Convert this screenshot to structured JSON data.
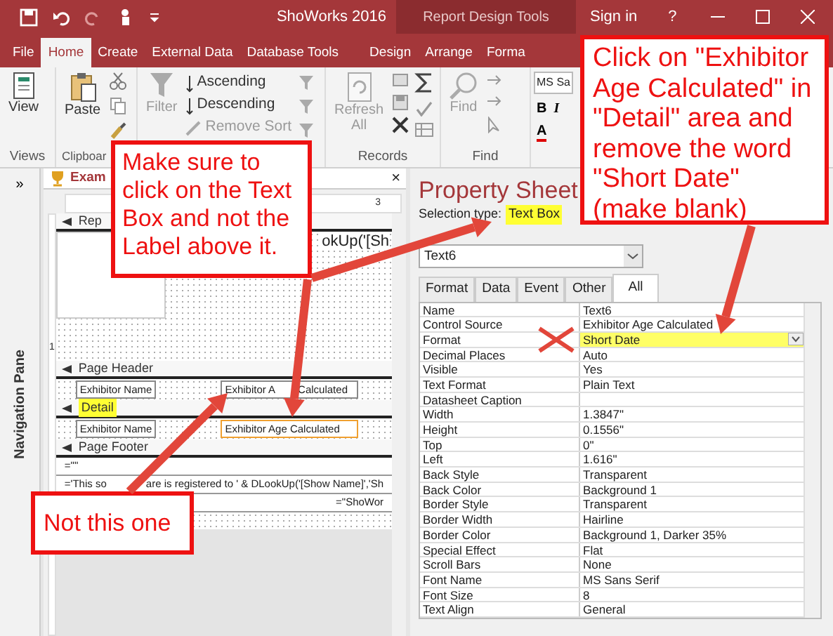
{
  "title_bar": {
    "title": "ShoWorks 2016",
    "context": "Report Design Tools",
    "sign_in": "Sign in",
    "help": "?"
  },
  "ribbon_tabs": [
    {
      "label": "File",
      "selected": false
    },
    {
      "label": "Home",
      "selected": true
    },
    {
      "label": "Create",
      "selected": false
    },
    {
      "label": "External Data",
      "selected": false
    },
    {
      "label": "Database Tools",
      "selected": false
    },
    {
      "label": "Design",
      "selected": false
    },
    {
      "label": "Arrange",
      "selected": false
    },
    {
      "label": "Forma",
      "selected": false
    }
  ],
  "ribbon": {
    "view": "View",
    "paste": "Paste",
    "filter": {
      "label": "Filter",
      "disabled": true
    },
    "sort": [
      {
        "label": "Ascending",
        "disabled": false
      },
      {
        "label": "Descending",
        "disabled": false
      },
      {
        "label": "Remove Sort",
        "disabled": true
      }
    ],
    "refresh": {
      "lines": [
        "Refresh",
        "All"
      ],
      "disabled": true
    },
    "find": {
      "label": "Find",
      "disabled": true
    },
    "font_name": "MS Sa",
    "format_buttons": [
      "B",
      "I",
      "A"
    ],
    "group_labels": [
      "Views",
      "Clipboar",
      "Records",
      "Find"
    ]
  },
  "navigation_pane": {
    "expand": "»",
    "label": "Navigation Pane"
  },
  "report_design": {
    "tab": "Exam",
    "close": "×",
    "ruler_mark": "3",
    "side_mark": "1",
    "sections": [
      {
        "kind": "band",
        "label": "Rep",
        "highlighted": false
      },
      {
        "kind": "header_area",
        "text": "okUp('[Sh"
      },
      {
        "kind": "band",
        "label": "Page Header",
        "highlighted": false
      },
      {
        "kind": "controls",
        "cells": [
          {
            "texts": [
              "Exhibitor Name"
            ],
            "selected": false
          },
          {
            "texts": [
              "Exhibitor A",
              "Calculated"
            ],
            "selected": false
          }
        ]
      },
      {
        "kind": "band",
        "label": "Detail",
        "highlighted": true
      },
      {
        "kind": "controls",
        "cells": [
          {
            "texts": [
              "Exhibitor Name"
            ],
            "selected": false
          },
          {
            "texts": [
              "Exhibitor Age Calculated"
            ],
            "selected": true
          }
        ]
      },
      {
        "kind": "band",
        "label": "Page Footer",
        "highlighted": false
      },
      {
        "kind": "expression",
        "texts": [
          "=\"\""
        ]
      },
      {
        "kind": "expression",
        "texts": [
          "='This so",
          "are is registered to ' & DLookUp('[Show Name]','Sh"
        ]
      },
      {
        "kind": "right_expression",
        "texts": [
          "=\"ShoWor"
        ]
      }
    ]
  },
  "property_sheet": {
    "title": "Property Sheet",
    "selection_label": "Selection type:",
    "selection_type": "Text Box",
    "object": "Text6",
    "tabs": [
      {
        "label": "Format",
        "selected": false
      },
      {
        "label": "Data",
        "selected": false
      },
      {
        "label": "Event",
        "selected": false
      },
      {
        "label": "Other",
        "selected": false
      },
      {
        "label": "All",
        "selected": true
      }
    ],
    "rows": [
      {
        "name": "Name",
        "value": "Text6",
        "highlighted": false
      },
      {
        "name": "Control Source",
        "value": "Exhibitor Age Calculated",
        "highlighted": false
      },
      {
        "name": "Format",
        "value": "Short Date",
        "highlighted": true
      },
      {
        "name": "Decimal Places",
        "value": "Auto",
        "highlighted": false
      },
      {
        "name": "Visible",
        "value": "Yes",
        "highlighted": false
      },
      {
        "name": "Text Format",
        "value": "Plain Text",
        "highlighted": false
      },
      {
        "name": "Datasheet Caption",
        "highlighted": false
      },
      {
        "name": "Width",
        "value": "1.3847\"",
        "highlighted": false
      },
      {
        "name": "Height",
        "value": "0.1556\"",
        "highlighted": false
      },
      {
        "name": "Top",
        "value": "0\"",
        "highlighted": false
      },
      {
        "name": "Left",
        "value": "1.616\"",
        "highlighted": false
      },
      {
        "name": "Back Style",
        "value": "Transparent",
        "highlighted": false
      },
      {
        "name": "Back Color",
        "value": "Background 1",
        "highlighted": false
      },
      {
        "name": "Border Style",
        "value": "Transparent",
        "highlighted": false
      },
      {
        "name": "Border Width",
        "value": "Hairline",
        "highlighted": false
      },
      {
        "name": "Border Color",
        "value": "Background 1, Darker 35%",
        "highlighted": false
      },
      {
        "name": "Special Effect",
        "value": "Flat",
        "highlighted": false
      },
      {
        "name": "Scroll Bars",
        "value": "None",
        "highlighted": false
      },
      {
        "name": "Font Name",
        "value": "MS Sans Serif",
        "highlighted": false
      },
      {
        "name": "Font Size",
        "value": "8",
        "highlighted": false
      },
      {
        "name": "Text Align",
        "value": "General",
        "highlighted": false
      }
    ]
  },
  "annotations": [
    {
      "text": "Click on \"Exhibitor Age Calculated\" in \"Detail\" area and remove the word \"Short Date\" (make blank)"
    },
    {
      "text": "Make sure to click on the Text Box and not the Label above it."
    },
    {
      "text": "Not this one"
    }
  ]
}
